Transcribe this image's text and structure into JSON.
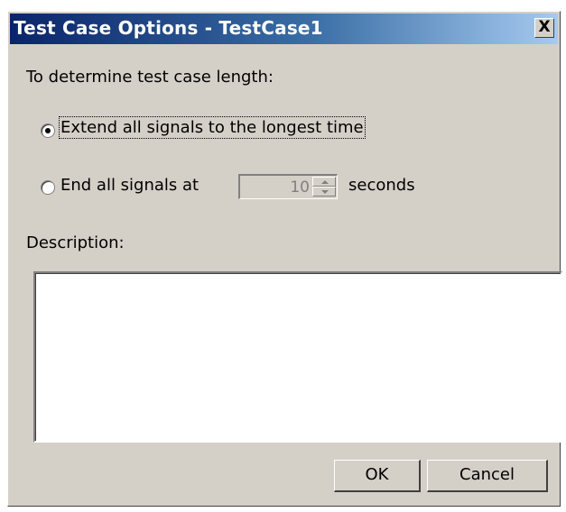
{
  "window": {
    "title": "Test Case Options  - TestCase1",
    "close_glyph": "X"
  },
  "section": {
    "length_heading": "To determine test case length:"
  },
  "options": {
    "extend": {
      "label": "Extend all signals to the longest time",
      "selected": true
    },
    "end_at": {
      "label": "End all signals at",
      "selected": false,
      "value": "10",
      "unit": "seconds"
    }
  },
  "description": {
    "label": "Description:",
    "value": ""
  },
  "buttons": {
    "ok": "OK",
    "cancel": "Cancel"
  },
  "colors": {
    "title_gradient_start": "#0a246a",
    "title_gradient_end": "#a6caf0",
    "dialog_face": "#d4d0c8"
  }
}
